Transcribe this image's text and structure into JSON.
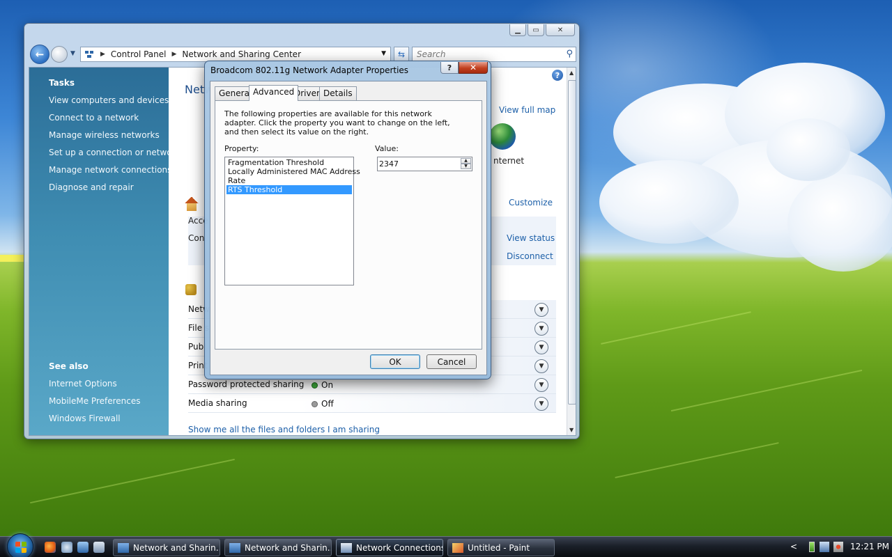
{
  "explorer": {
    "address": {
      "segments": [
        "Control Panel",
        "Network and Sharing Center"
      ],
      "search_placeholder": "Search"
    },
    "left_pane": {
      "tasks_heading": "Tasks",
      "tasks": [
        "View computers and devices",
        "Connect to a network",
        "Manage wireless networks",
        "Set up a connection or network",
        "Manage network connections",
        "Diagnose and repair"
      ],
      "see_also_heading": "See also",
      "see_also": [
        "Internet Options",
        "MobileMe Preferences",
        "Windows Firewall"
      ]
    },
    "main": {
      "title_partial": "Netw",
      "view_full_map": "View full map",
      "internet_partial": "nternet",
      "customize": "Customize",
      "access_partial": "Acce",
      "connection_partial": "Con",
      "view_status": "View status",
      "disconnect": "Disconnect",
      "sharing_rows": [
        {
          "label": "Netw",
          "state": "",
          "status": ""
        },
        {
          "label": "File s",
          "state": "",
          "status": ""
        },
        {
          "label": "Publ",
          "state": "",
          "status": ""
        },
        {
          "label": "Print",
          "state": "",
          "status": ""
        },
        {
          "label": "Password protected sharing",
          "state": "On",
          "status": "on"
        },
        {
          "label": "Media sharing",
          "state": "Off",
          "status": "off"
        }
      ],
      "show_files_link": "Show me all the files and folders I am sharing"
    }
  },
  "dialog": {
    "title": "Broadcom 802.11g Network Adapter Properties",
    "help_btn": "?",
    "close_btn": "✕",
    "tabs": [
      "General",
      "Advanced",
      "Driver",
      "Details"
    ],
    "active_tab": "Advanced",
    "description": "The following properties are available for this network adapter. Click the property you want to change on the left, and then select its value on the right.",
    "property_label": "Property:",
    "value_label": "Value:",
    "properties": [
      "Fragmentation Threshold",
      "Locally Administered MAC Address",
      "Rate",
      "RTS Threshold"
    ],
    "selected_property": "RTS Threshold",
    "value": "2347",
    "ok": "OK",
    "cancel": "Cancel"
  },
  "taskbar": {
    "tasks": [
      {
        "label": "Network and Sharin...",
        "active": false
      },
      {
        "label": "Network and Sharin...",
        "active": false
      },
      {
        "label": "Network Connections",
        "active": true
      },
      {
        "label": "Untitled - Paint",
        "active": false
      }
    ],
    "clock": "12:21 PM"
  }
}
